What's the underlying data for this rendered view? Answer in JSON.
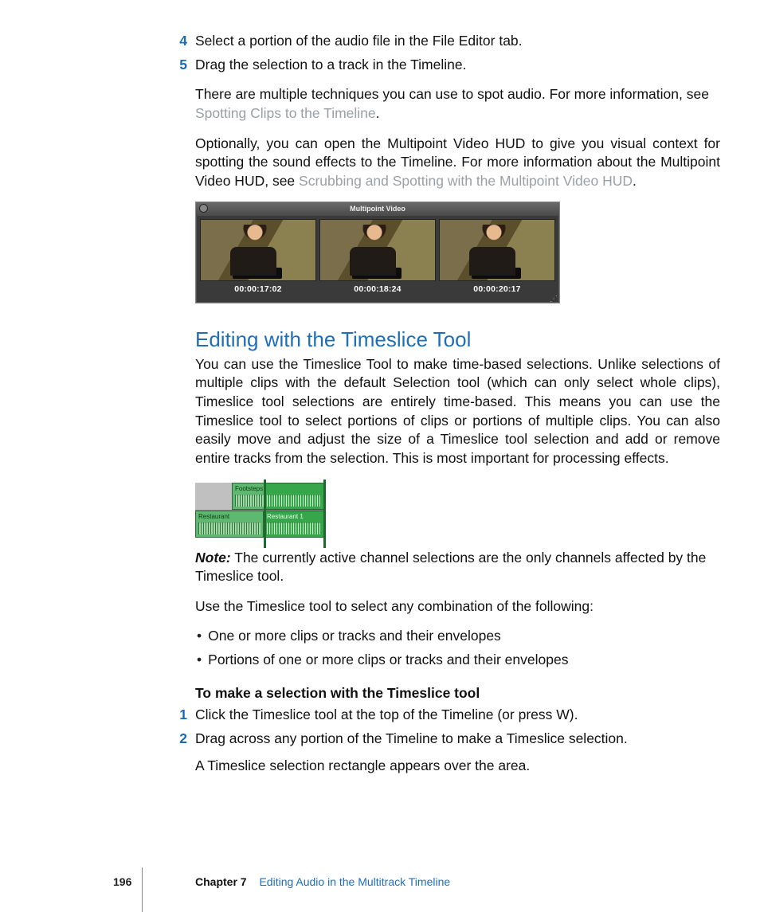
{
  "steps_a": [
    {
      "num": "4",
      "text": "Select a portion of the audio file in the File Editor tab."
    },
    {
      "num": "5",
      "text": "Drag the selection to a track in the Timeline."
    }
  ],
  "para1_a": "There are multiple techniques you can use to spot audio. For more information, see ",
  "para1_link": "Spotting Clips to the Timeline",
  "para1_b": ".",
  "para2_a": "Optionally, you can open the Multipoint Video HUD to give you visual context for spotting the sound effects to the Timeline. For more information about the Multipoint Video HUD, see ",
  "para2_link": "Scrubbing and Spotting with the Multipoint Video HUD",
  "para2_b": ".",
  "hud_title": "Multipoint Video",
  "timecodes": [
    "00:00:17:02",
    "00:00:18:24",
    "00:00:20:17"
  ],
  "heading": "Editing with the Timeslice Tool",
  "section_para": "You can use the Timeslice Tool to make time-based selections. Unlike selections of multiple clips with the default Selection tool (which can only select whole clips), Timeslice tool selections are entirely time-based. This means you can use the Timeslice tool to select portions of clips or portions of multiple clips. You can also easily move and adjust the size of a Timeslice tool selection and add or remove entire tracks from the selection. This is most important for processing effects.",
  "clips": {
    "top_label": "Footsteps Hard Concre",
    "left_label": "Restaurant",
    "right_label": "Restaurant 1"
  },
  "note_label": "Note:",
  "note_text": "  The currently active channel selections are the only channels affected by the Timeslice tool.",
  "use_intro": "Use the Timeslice tool to select any combination of the following:",
  "bullets": [
    "One or more clips or tracks and their envelopes",
    "Portions of one or more clips or tracks and their envelopes"
  ],
  "subhead": "To make a selection with the Timeslice tool",
  "steps_b": [
    {
      "num": "1",
      "text": "Click the Timeslice tool at the top of the Timeline (or press W)."
    },
    {
      "num": "2",
      "text": "Drag across any portion of the Timeline to make a Timeslice selection."
    }
  ],
  "result_text": "A Timeslice selection rectangle appears over the area.",
  "footer": {
    "page": "196",
    "chapter_label": "Chapter 7",
    "chapter_title": "Editing Audio in the Multitrack Timeline"
  }
}
